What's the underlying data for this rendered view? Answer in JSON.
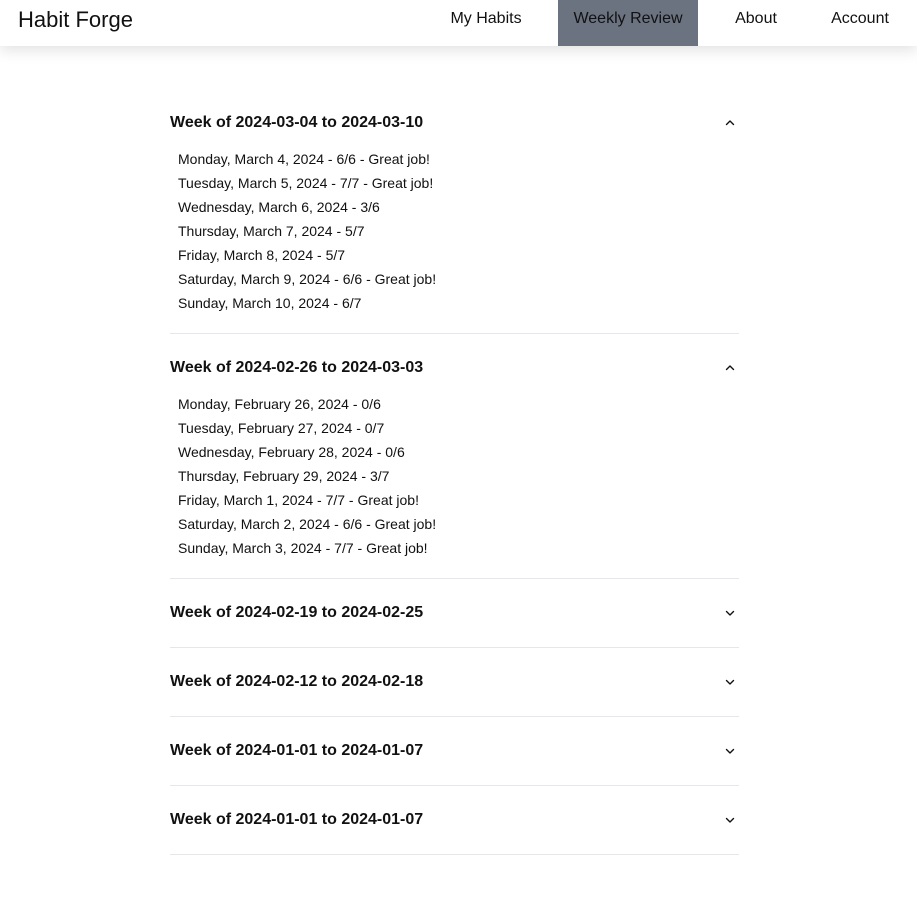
{
  "brand": "Habit Forge",
  "nav": {
    "my_habits": "My Habits",
    "weekly_review": "Weekly Review",
    "about": "About",
    "account": "Account",
    "active": "weekly_review"
  },
  "colors": {
    "active_nav_bg": "#6b7280",
    "divider": "#e5e7eb"
  },
  "weeks": [
    {
      "title": "Week of 2024-03-04 to 2024-03-10",
      "expanded": true,
      "days": [
        "Monday, March 4, 2024 - 6/6 - Great job!",
        "Tuesday, March 5, 2024 - 7/7 - Great job!",
        "Wednesday, March 6, 2024 - 3/6",
        "Thursday, March 7, 2024 - 5/7",
        "Friday, March 8, 2024 - 5/7",
        "Saturday, March 9, 2024 - 6/6 - Great job!",
        "Sunday, March 10, 2024 - 6/7"
      ]
    },
    {
      "title": "Week of 2024-02-26 to 2024-03-03",
      "expanded": true,
      "days": [
        "Monday, February 26, 2024 - 0/6",
        "Tuesday, February 27, 2024 - 0/7",
        "Wednesday, February 28, 2024 - 0/6",
        "Thursday, February 29, 2024 - 3/7",
        "Friday, March 1, 2024 - 7/7 - Great job!",
        "Saturday, March 2, 2024 - 6/6 - Great job!",
        "Sunday, March 3, 2024 - 7/7 - Great job!"
      ]
    },
    {
      "title": "Week of 2024-02-19 to 2024-02-25",
      "expanded": false,
      "days": []
    },
    {
      "title": "Week of 2024-02-12 to 2024-02-18",
      "expanded": false,
      "days": []
    },
    {
      "title": "Week of 2024-01-01 to 2024-01-07",
      "expanded": false,
      "days": []
    },
    {
      "title": "Week of 2024-01-01 to 2024-01-07",
      "expanded": false,
      "days": []
    }
  ]
}
